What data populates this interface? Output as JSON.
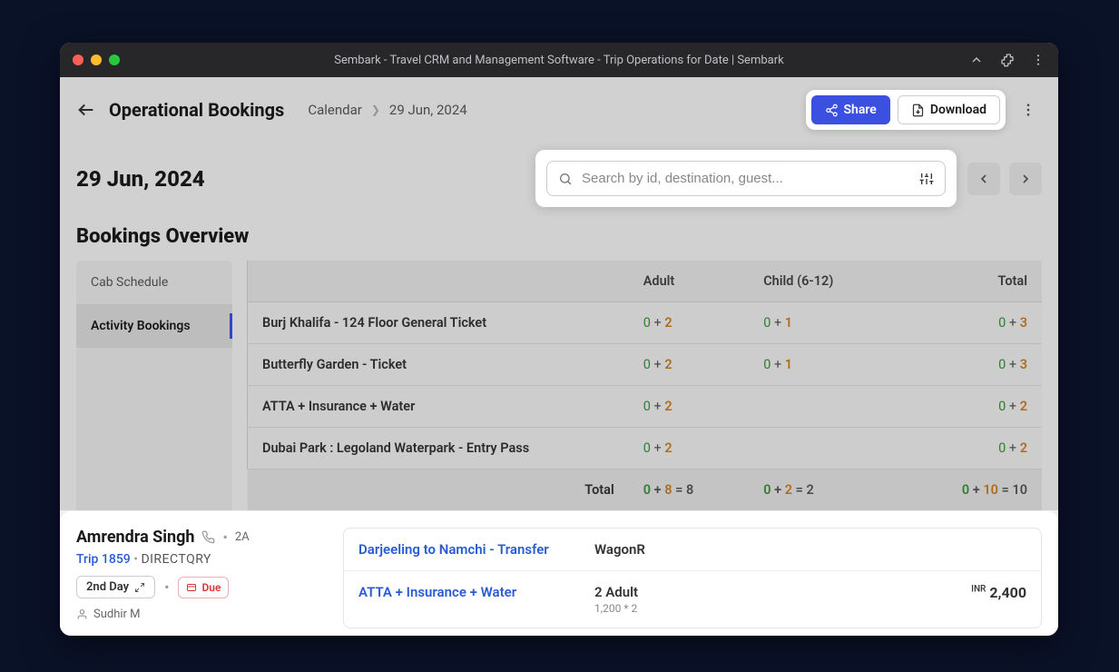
{
  "titlebar": {
    "title": "Sembark - Travel CRM and Management Software - Trip Operations for Date | Sembark"
  },
  "header": {
    "page_title": "Operational Bookings",
    "breadcrumb": {
      "calendar": "Calendar",
      "date": "29 Jun, 2024"
    },
    "share_label": "Share",
    "download_label": "Download"
  },
  "date_heading": "29 Jun, 2024",
  "search": {
    "placeholder": "Search by id, destination, guest..."
  },
  "section_title": "Bookings Overview",
  "tabs": {
    "cab": "Cab Schedule",
    "activity": "Activity Bookings"
  },
  "table": {
    "headers": {
      "name": "",
      "adult": "Adult",
      "child": "Child (6-12)",
      "total": "Total"
    },
    "rows": [
      {
        "name": "Burj Khalifa - 124 Floor General Ticket",
        "adult_a": "0",
        "adult_b": "2",
        "child_a": "0",
        "child_b": "1",
        "total_a": "0",
        "total_b": "3"
      },
      {
        "name": "Butterfly Garden - Ticket",
        "adult_a": "0",
        "adult_b": "2",
        "child_a": "0",
        "child_b": "1",
        "total_a": "0",
        "total_b": "3"
      },
      {
        "name": "ATTA + Insurance + Water",
        "adult_a": "0",
        "adult_b": "2",
        "child_a": "",
        "child_b": "",
        "total_a": "0",
        "total_b": "2"
      },
      {
        "name": "Dubai Park : Legoland Waterpark - Entry Pass",
        "adult_a": "0",
        "adult_b": "2",
        "child_a": "",
        "child_b": "",
        "total_a": "0",
        "total_b": "2"
      }
    ],
    "footer": {
      "label": "Total",
      "adult": {
        "a": "0",
        "b": "8",
        "eq": "8"
      },
      "child": {
        "a": "0",
        "b": "2",
        "eq": "2"
      },
      "total": {
        "a": "0",
        "b": "10",
        "eq": "10"
      }
    }
  },
  "detail": {
    "guest": {
      "name": "Amrendra Singh",
      "pax": "2A",
      "trip_label": "Trip 1859",
      "source": "DIRECTQRY",
      "day_badge": "2nd Day",
      "due_label": "Due",
      "rep": "Sudhir M"
    },
    "items": [
      {
        "link": "Darjeeling to Namchi - Transfer",
        "mid": "WagonR",
        "sub": "",
        "price_curr": "",
        "price": ""
      },
      {
        "link": "ATTA + Insurance + Water",
        "mid": "2 Adult",
        "sub": "1,200 * 2",
        "price_curr": "INR",
        "price": "2,400"
      }
    ]
  }
}
